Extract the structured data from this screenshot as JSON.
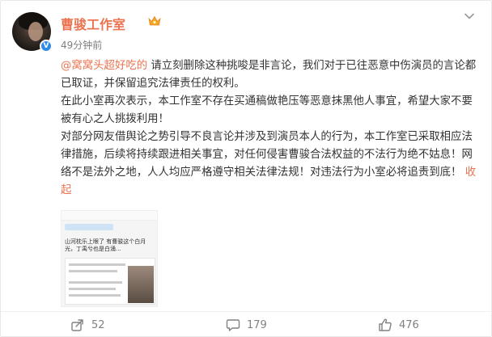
{
  "post": {
    "author": "曹骏工作室",
    "time": "49分钟前",
    "mention": "@窝窝头超好吃的",
    "para1_rest": " 请立刻删除这种挑唆是非言论，我们对于已往恶意中伤演员的言论都已取证，并保留追究法律责任的权利。",
    "para2": "在此小室再次表示，本工作室不存在买通稿做艳压等恶意抹黑他人事宜，希望大家不要被有心之人挑拨利用！",
    "para3": "对部分网友借舆论之势引导不良言论并涉及到演员本人的行为，本工作室已采取相应法律措施，后续将持续跟进相关事宜，对任何侵害曹骏合法权益的不法行为绝不姑息！网络不是法外之地，人人均应严格遵守相关法律法规！对违法行为小室必将追责到底！",
    "collapse": "收起",
    "thumb_text": "山河枕乐上眼了 有曹骏这个白月光，丁禹兮也是白涌..."
  },
  "actions": {
    "share_count": "52",
    "comment_count": "179",
    "like_count": "476"
  },
  "icons": {
    "more": "chevron-down-icon",
    "share": "share-icon",
    "comment": "comment-icon",
    "like": "thumbs-up-icon",
    "verified": "verified-badge-icon",
    "vip": "crown-icon"
  },
  "colors": {
    "accent": "#eb7350",
    "muted": "#808080",
    "verified": "#2e8ce6"
  }
}
